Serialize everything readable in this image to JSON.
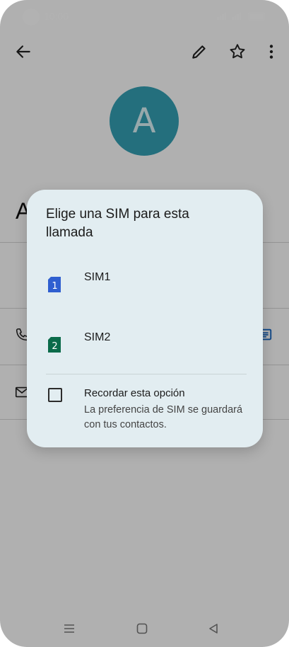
{
  "status_bar": {
    "time": "10:00"
  },
  "contact": {
    "avatar_letter": "A",
    "name_initial": "A"
  },
  "dialog": {
    "title": "Elige una SIM para esta llamada",
    "options": [
      {
        "label": "SIM1",
        "badge": "1",
        "color": "#2f5fd0"
      },
      {
        "label": "SIM2",
        "badge": "2",
        "color": "#0b6b4a"
      }
    ],
    "remember": {
      "label": "Recordar esta opción",
      "description": "La preferencia de SIM se guardará con tus contactos.",
      "checked": false
    }
  },
  "colors": {
    "avatar": "#34a0b4",
    "dialog_bg": "#e2edf1",
    "scrim": "rgba(0,0,0,0.30)"
  },
  "icons": {
    "back": "arrow-left-icon",
    "edit": "pencil-icon",
    "favorite": "star-icon",
    "more": "more-vert-icon",
    "phone": "phone-icon",
    "mail": "mail-icon",
    "message": "message-icon"
  }
}
